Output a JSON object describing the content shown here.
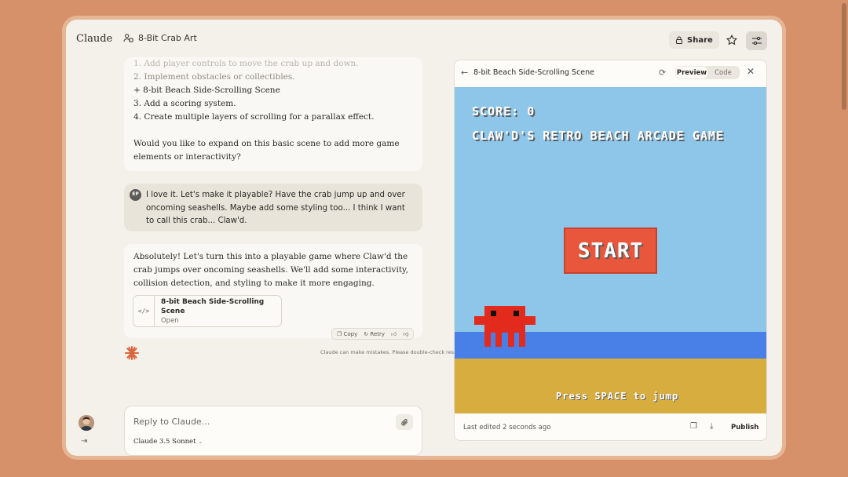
{
  "app": {
    "logo": "Claude"
  },
  "header": {
    "project_icon": "project-icon",
    "project_title": "8-Bit Crab Art",
    "share_label": "Share",
    "share_icon": "lock-icon",
    "star_icon": "star-icon",
    "settings_icon": "sliders-icon"
  },
  "chat": {
    "assistant_list": [
      "1. Add player controls to move the crab up and down.",
      "2. Implement obstacles or collectibles.",
      "+ 8-bit Beach Side-Scrolling Scene",
      "3. Add a scoring system.",
      "4. Create multiple layers of scrolling for a parallax effect."
    ],
    "assistant_question": "Would you like to expand on this basic scene to add more game elements or interactivity?",
    "user_initials": "EP",
    "user_message": "I love it. Let's make it playable? Have the crab jump up and over oncoming seashells. Maybe add some styling too... I think I want to call this crab... Claw'd.",
    "reply_text": "Absolutely! Let's turn this into a playable game where Claw'd the crab jumps over oncoming seashells. We'll add some interactivity, collision detection, and styling to make it more engaging.",
    "artifact_card": {
      "icon": "</>",
      "title": "8-bit Beach Side-Scrolling Scene",
      "subtitle": "Open"
    },
    "actions": {
      "copy": "Copy",
      "retry": "Retry"
    },
    "disclaimer": "Claude can make mistakes. Please double-check responses."
  },
  "input": {
    "placeholder": "Reply to Claude...",
    "model": "Claude 3.5 Sonnet"
  },
  "artifact_panel": {
    "title": "8-bit Beach Side-Scrolling Scene",
    "tabs": {
      "preview": "Preview",
      "code": "Code"
    },
    "active_tab": "preview",
    "game": {
      "score": "SCORE: 0",
      "title": "CLAW'D'S RETRO BEACH ARCADE GAME",
      "start": "START",
      "hint": "Press SPACE to jump",
      "colors": {
        "sky": "#8ec6ea",
        "water": "#4980e8",
        "sand": "#d8ad3f",
        "crab": "#e22b1c",
        "start": "#e8563b"
      }
    },
    "footer": {
      "last_edited": "Last edited 2 seconds ago",
      "publish": "Publish"
    }
  }
}
